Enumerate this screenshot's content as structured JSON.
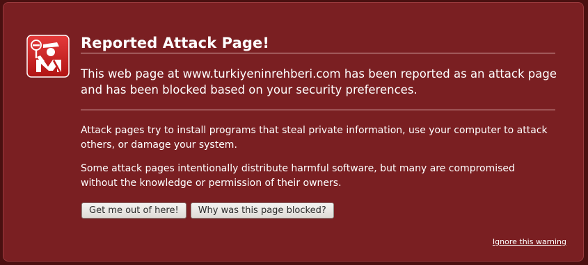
{
  "page": {
    "title": "Reported Attack Page!",
    "short_description": "This web page at www.turkiyeninrehberi.com has been reported as an attack page and has been blocked based on your security preferences.",
    "paragraphs": [
      "Attack pages try to install programs that steal private information, use your computer to attack others, or damage your system.",
      "Some attack pages intentionally distribute harmful software, but many are compromised without the knowledge or permission of their owners."
    ]
  },
  "buttons": {
    "get_me_out": "Get me out of here!",
    "why_blocked": "Why was this page blocked?"
  },
  "ignore_warning": "Ignore this warning",
  "colors": {
    "background": "#7a1f22",
    "icon_red": "#cc1f1f",
    "text": "#ffffff"
  },
  "icons": {
    "warning": "police-officer-warning-icon"
  }
}
